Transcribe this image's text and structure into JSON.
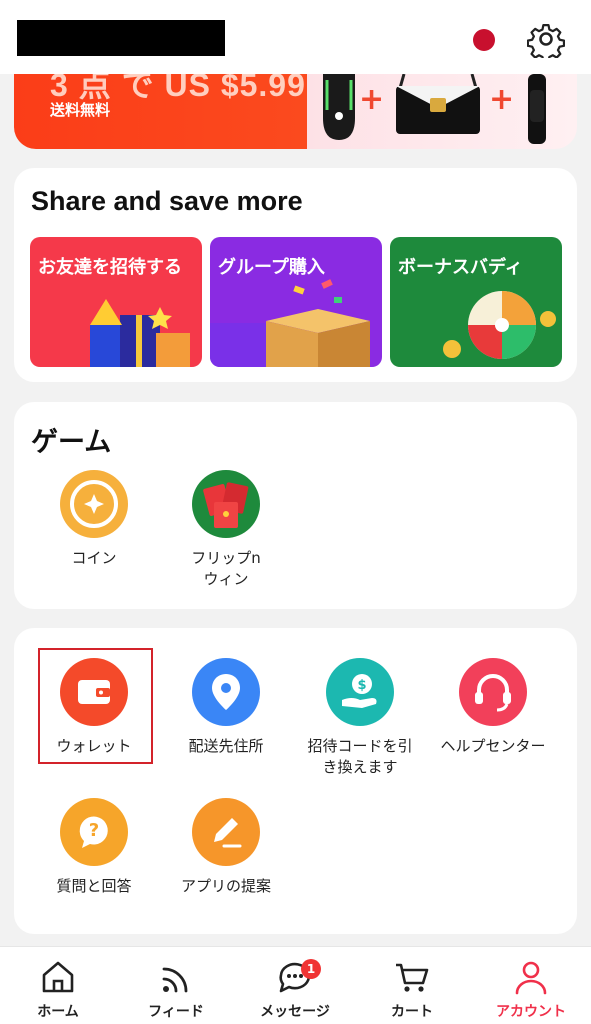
{
  "banner": {
    "headline": "3 点 で US $5.99",
    "subtext": "送料無料"
  },
  "share": {
    "title": "Share and save more",
    "tiles": [
      {
        "label": "お友達を招待する",
        "color": "#f5394a"
      },
      {
        "label": "グループ購入",
        "color": "#8a2be2"
      },
      {
        "label": "ボーナスバディ",
        "color": "#1e8a3c"
      }
    ]
  },
  "games": {
    "title": "ゲーム",
    "items": [
      {
        "label": "コイン"
      },
      {
        "label": "フリップn\nウィン"
      }
    ]
  },
  "services": {
    "items": [
      {
        "label": "ウォレット"
      },
      {
        "label": "配送先住所"
      },
      {
        "label": "招待コードを引\nき換えます"
      },
      {
        "label": "ヘルプセンター"
      },
      {
        "label": "質問と回答"
      },
      {
        "label": "アプリの提案"
      }
    ]
  },
  "nav": {
    "items": [
      {
        "label": "ホーム"
      },
      {
        "label": "フィード"
      },
      {
        "label": "メッセージ",
        "badge": "1"
      },
      {
        "label": "カート"
      },
      {
        "label": "アカウント"
      }
    ]
  },
  "colors": {
    "accent": "#f0304a",
    "highlight_box": "#d3232a"
  }
}
